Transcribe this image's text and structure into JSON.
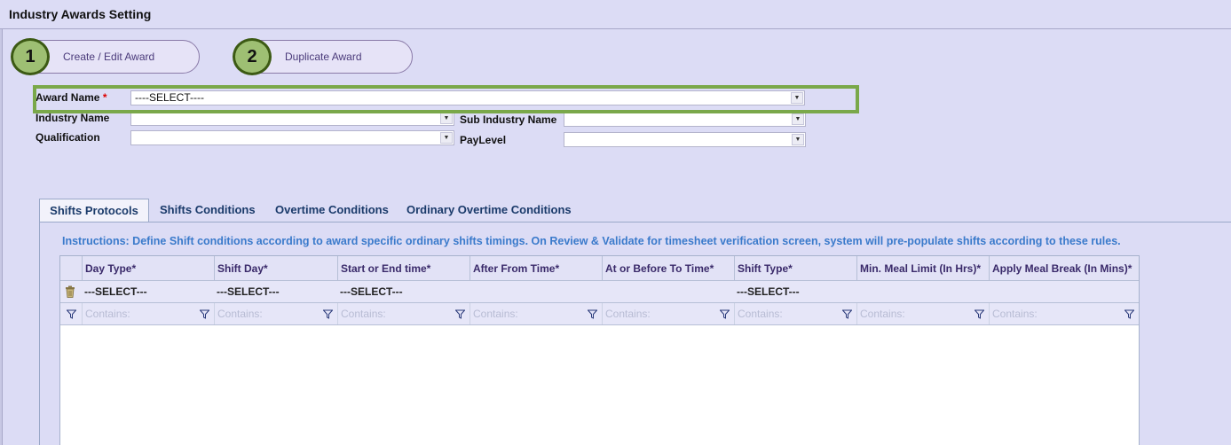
{
  "window": {
    "title": "Industry Awards Setting"
  },
  "steps": [
    {
      "number": "1",
      "label": "Create  / Edit Award"
    },
    {
      "number": "2",
      "label": "Duplicate Award"
    }
  ],
  "form": {
    "award_name": {
      "label": "Award Name",
      "required_mark": "*",
      "value": "----SELECT----"
    },
    "industry_name": {
      "label": "Industry Name",
      "value": ""
    },
    "sub_industry_name": {
      "label": "Sub Industry Name",
      "value": ""
    },
    "qualification": {
      "label": "Qualification",
      "value": ""
    },
    "pay_level": {
      "label": "PayLevel",
      "value": ""
    }
  },
  "tabs": [
    {
      "label": "Shifts Protocols",
      "active": true
    },
    {
      "label": "Shifts Conditions",
      "active": false
    },
    {
      "label": "Overtime Conditions",
      "active": false
    },
    {
      "label": "Ordinary Overtime Conditions",
      "active": false
    }
  ],
  "instructions": "Instructions: Define Shift conditions according to award specific ordinary shifts timings. On Review & Validate for timesheet verification screen, system will pre-populate shifts according to these rules.",
  "grid": {
    "columns": [
      "Day Type*",
      "Shift Day*",
      "Start or End time*",
      "After From Time*",
      "At or Before To Time*",
      "Shift Type*",
      "Min. Meal Limit (In Hrs)*",
      "Apply Meal Break (In Mins)*"
    ],
    "new_row": [
      "---SELECT---",
      "---SELECT---",
      "---SELECT---",
      "",
      "",
      "---SELECT---",
      "",
      ""
    ],
    "filter_placeholder": "Contains:"
  },
  "colors": {
    "accent_green": "#7aa84a",
    "tab_text": "#1a3a6a",
    "instruction_text": "#3a7acb",
    "background": "#dcdcf5"
  },
  "icons": {
    "step_marker": "numbered-circle",
    "delete": "trash-icon",
    "filter": "funnel-icon",
    "dropdown": "chevron-down-icon"
  }
}
